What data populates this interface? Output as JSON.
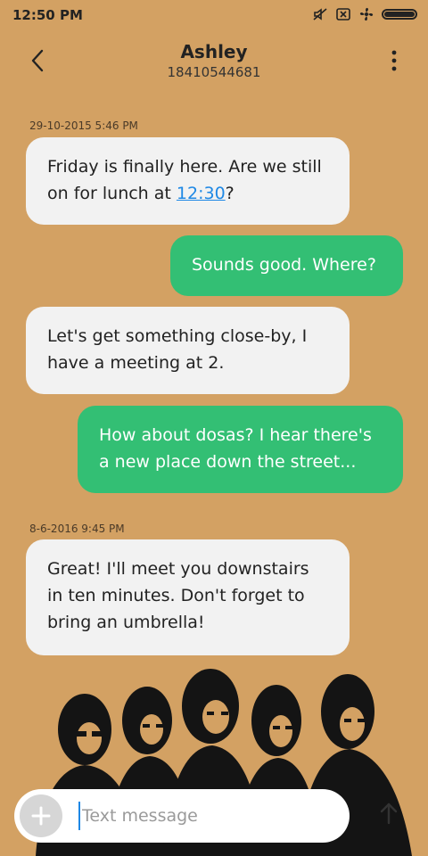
{
  "status_bar": {
    "time": "12:50 PM",
    "icons": [
      "mute-icon",
      "sim-off-icon",
      "fan-icon",
      "battery-icon"
    ],
    "battery_level": 1.0
  },
  "header": {
    "contact_name": "Ashley",
    "contact_number": "18410544681",
    "back_icon": "chevron-left-icon",
    "more_icon": "more-vertical-icon"
  },
  "conversation": {
    "timestamp_1": "29-10-2015 5:46 PM",
    "msg_1_before_link": "Friday is finally here. Are we still on for lunch at ",
    "msg_1_link": "12:30",
    "msg_1_after_link": "?",
    "msg_2": "Sounds good. Where?",
    "msg_3": "Let's get something close-by, I have a meeting at 2.",
    "msg_4": "How about dosas? I hear there's a new place down the street...",
    "timestamp_2": "8-6-2016 9:45 PM",
    "msg_5": "Great! I'll meet you downstairs in ten minutes. Don't forget to bring an umbrella!"
  },
  "composer": {
    "placeholder": "Text message",
    "value": "",
    "add_icon": "plus-icon",
    "send_icon": "arrow-up-icon"
  },
  "colors": {
    "wallpaper": "#d3a163",
    "received_bubble": "#f2f2f2",
    "sent_bubble": "#33bf74",
    "link": "#1e88e5"
  }
}
